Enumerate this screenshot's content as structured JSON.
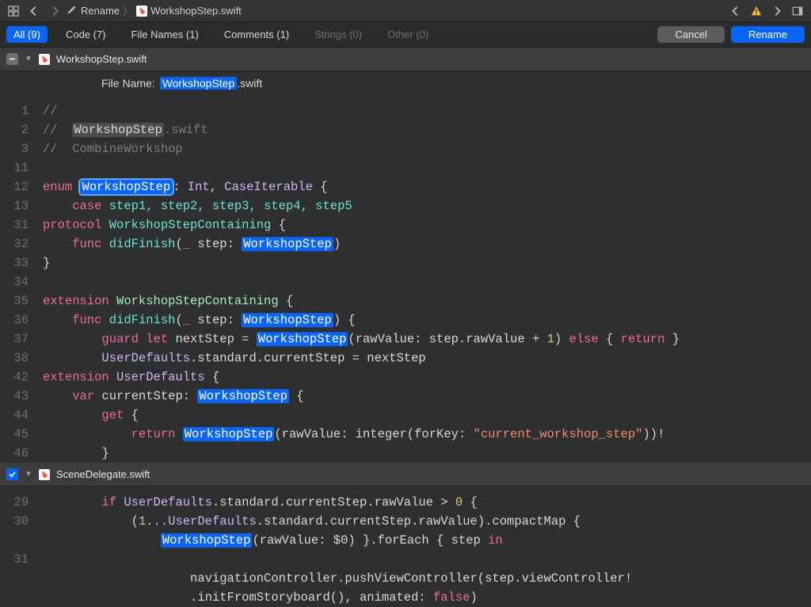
{
  "navbar": {
    "breadcrumb": {
      "rename": "Rename",
      "file": "WorkshopStep.swift"
    }
  },
  "scope": {
    "all": "All (9)",
    "code": "Code (7)",
    "filenames": "File Names (1)",
    "comments": "Comments (1)",
    "strings": "Strings (0)",
    "other": "Other (0)",
    "cancel": "Cancel",
    "rename": "Rename"
  },
  "file1": {
    "header": "WorkshopStep.swift",
    "filename_label": "File Name: ",
    "filename_edit": "WorkshopStep",
    "filename_ext": ".swift"
  },
  "code1": {
    "l1_gutter": "1",
    "l1": "//",
    "l2_gutter": "2",
    "l2_pre": "//  ",
    "l2_hl": "WorkshopStep",
    "l2_post": ".swift",
    "l3_gutter": "3",
    "l3": "//  CombineWorkshop",
    "l11_gutter": "11",
    "l12_gutter": "12",
    "l12_enum": "enum",
    "l12_name": "WorkshopStep",
    "l12_rest_a": ": ",
    "l12_int": "Int",
    "l12_comma": ", ",
    "l12_ci": "CaseIterable",
    "l12_brace": " {",
    "l13_gutter": "13",
    "l13_case": "case",
    "l13_rest": " step1, step2, step3, step4, step5",
    "l31_gutter": "31",
    "l31_protocol": "protocol",
    "l31_name": " WorkshopStepContaining",
    "l31_brace": " {",
    "l32_gutter": "32",
    "l32_func": "func",
    "l32_name": " didFinish",
    "l32_p1": "(",
    "l32_under": "_",
    "l32_p2": " step: ",
    "l32_type": "WorkshopStep",
    "l32_p3": ")",
    "l33_gutter": "33",
    "l33": "}",
    "l34_gutter": "34",
    "l35_gutter": "35",
    "l35_ext": "extension",
    "l35_name": " WorkshopStepContaining",
    "l35_brace": " {",
    "l36_gutter": "36",
    "l36_func": "func",
    "l36_name": " didFinish",
    "l36_p1": "(",
    "l36_under": "_",
    "l36_p2": " step: ",
    "l36_type": "WorkshopStep",
    "l36_p3": ") {",
    "l37_gutter": "37",
    "l37_guard": "guard",
    "l37_let": " let",
    "l37_mid": " nextStep = ",
    "l37_type": "WorkshopStep",
    "l37_raw": "(rawValue: step.rawValue + ",
    "l37_num": "1",
    "l37_p": ") ",
    "l37_else": "else",
    "l37_br": " { ",
    "l37_return": "return",
    "l37_end": " }",
    "l38_gutter": "38",
    "l38_a": "UserDefaults",
    "l38_b": ".standard.currentStep = nextStep",
    "l42_gutter": "42",
    "l42_ext": "extension",
    "l42_name": " UserDefaults",
    "l42_brace": " {",
    "l43_gutter": "43",
    "l43_var": "var",
    "l43_name": " currentStep: ",
    "l43_type": "WorkshopStep",
    "l43_brace": " {",
    "l44_gutter": "44",
    "l44_get": "get",
    "l44_brace": " {",
    "l45_gutter": "45",
    "l45_return": "return",
    "l45_sp": " ",
    "l45_type": "WorkshopStep",
    "l45_a": "(rawValue: integer(forKey: ",
    "l45_str": "\"current_workshop_step\"",
    "l45_b": "))!",
    "l46_gutter": "46",
    "l46": "}"
  },
  "file2": {
    "header": "SceneDelegate.swift"
  },
  "code2": {
    "l29_gutter": "29",
    "l29_if": "if",
    "l29_a": " UserDefaults",
    "l29_b": ".standard.currentStep.rawValue > ",
    "l29_num": "0",
    "l29_c": " {",
    "l30a_gutter": "30",
    "l30a_a": "(",
    "l30a_num": "1",
    "l30a_b": "...UserDefaults",
    "l30a_c": ".standard.currentStep.rawValue).compactMap {",
    "l30b_gutter": "",
    "l30b_type": "WorkshopStep",
    "l30b_a": "(rawValue: $0) }.forEach { step ",
    "l30b_in": "in",
    "l31_gutter": "31",
    "l32_gutter": "",
    "l32_a": "navigationController.pushViewController(step.viewController!",
    "l33_gutter": "",
    "l33_a": ".initFromStoryboard(), animated: ",
    "l33_false": "false",
    "l33_b": ")"
  }
}
